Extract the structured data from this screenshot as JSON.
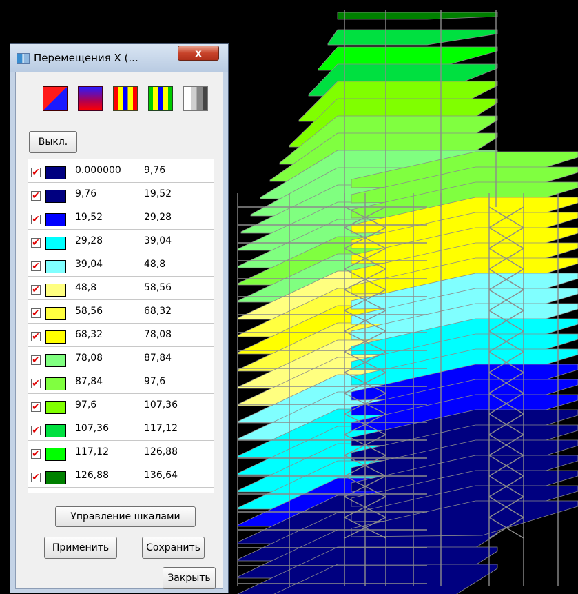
{
  "window": {
    "title": "Перемещения X (...",
    "close_glyph": "x"
  },
  "palette_buttons": [
    {
      "icon": "palette-red-blue-icon"
    },
    {
      "icon": "palette-blue-red-gradient-icon"
    },
    {
      "icon": "palette-red-yellow-blue-icon"
    },
    {
      "icon": "palette-green-yellow-blue-icon"
    },
    {
      "icon": "palette-grayscale-icon"
    }
  ],
  "off_button": "Выкл.",
  "scale_rows": [
    {
      "from": "0.000000",
      "to": "9,76",
      "color": "#000080"
    },
    {
      "from": "9,76",
      "to": "19,52",
      "color": "#000080"
    },
    {
      "from": "19,52",
      "to": "29,28",
      "color": "#0000ff"
    },
    {
      "from": "29,28",
      "to": "39,04",
      "color": "#00ffff"
    },
    {
      "from": "39,04",
      "to": "48,8",
      "color": "#80ffff"
    },
    {
      "from": "48,8",
      "to": "58,56",
      "color": "#ffff80"
    },
    {
      "from": "58,56",
      "to": "68,32",
      "color": "#ffff40"
    },
    {
      "from": "68,32",
      "to": "78,08",
      "color": "#ffff00"
    },
    {
      "from": "78,08",
      "to": "87,84",
      "color": "#80ff80"
    },
    {
      "from": "87,84",
      "to": "97,6",
      "color": "#80ff40"
    },
    {
      "from": "97,6",
      "to": "107,36",
      "color": "#80ff00"
    },
    {
      "from": "107,36",
      "to": "117,12",
      "color": "#00e040"
    },
    {
      "from": "117,12",
      "to": "126,88",
      "color": "#00ff00"
    },
    {
      "from": "126,88",
      "to": "136,64",
      "color": "#008000"
    }
  ],
  "check_glyph": "✔",
  "buttons": {
    "scales": "Управление шкалами",
    "apply": "Применить",
    "save": "Сохранить",
    "close": "Закрыть"
  }
}
